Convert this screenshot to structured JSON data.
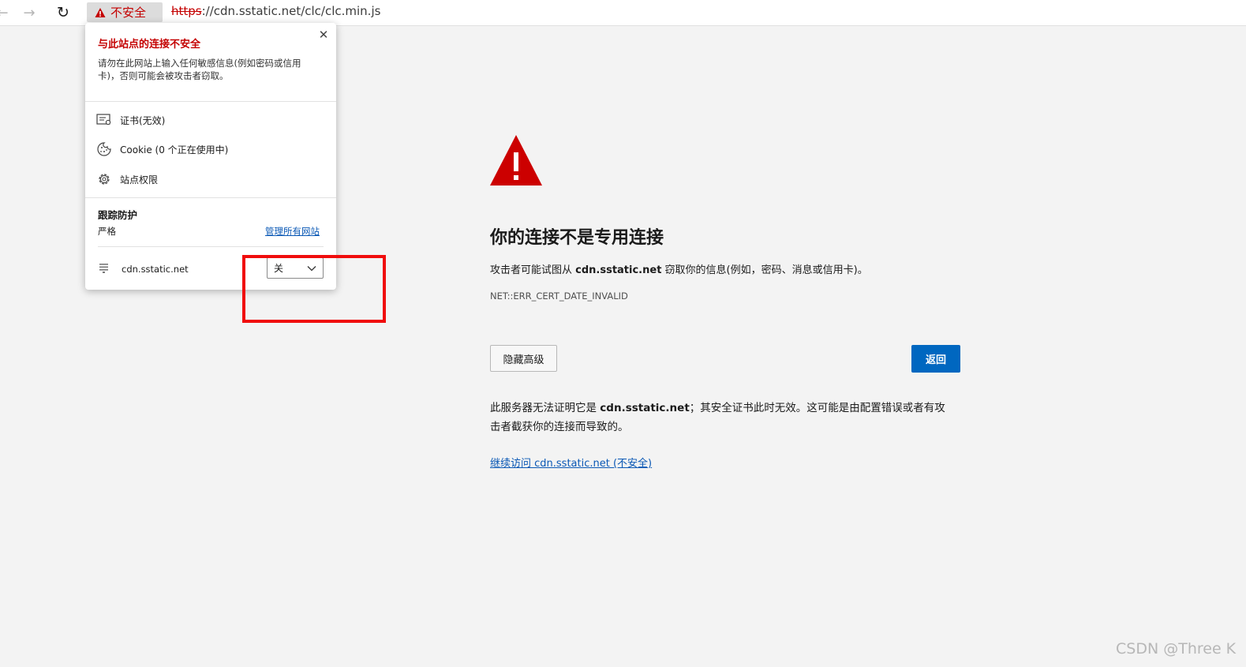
{
  "address_bar": {
    "security_label": "不安全",
    "url_scheme": "https",
    "url_rest": "://cdn.sstatic.net/clc/clc.min.js"
  },
  "error_page": {
    "title": "你的连接不是专用连接",
    "desc_prefix": "攻击者可能试图从 ",
    "desc_domain": "cdn.sstatic.net",
    "desc_suffix": " 窃取你的信息(例如，密码、消息或信用卡)。",
    "error_code": "NET::ERR_CERT_DATE_INVALID",
    "advanced_button": "隐藏高级",
    "back_button": "返回",
    "advanced_prefix": "此服务器无法证明它是 ",
    "advanced_domain": "cdn.sstatic.net",
    "advanced_suffix": "；其安全证书此时无效。这可能是由配置错误或者有攻击者截获你的连接而导致的。",
    "proceed_link": "继续访问 cdn.sstatic.net (不安全)"
  },
  "popup": {
    "close_glyph": "✕",
    "title": "与此站点的连接不安全",
    "warning": "请勿在此网站上输入任何敏感信息(例如密码或信用卡)，否则可能会被攻击者窃取。",
    "items": [
      {
        "label": "证书(无效)",
        "icon": "certificate-icon"
      },
      {
        "label": "Cookie (0 个正在使用中)",
        "icon": "cookie-icon"
      },
      {
        "label": "站点权限",
        "icon": "gear-icon"
      }
    ],
    "tracking": {
      "heading": "跟踪防护",
      "level": "严格",
      "manage_link": "管理所有网站"
    },
    "site": {
      "name": "cdn.sstatic.net",
      "toggle_value": "关"
    }
  },
  "watermark": "CSDN @Three K",
  "colors": {
    "danger": "#c40000",
    "accent": "#0067c0",
    "annotation": "#f00d0d",
    "link": "#0a58b5"
  }
}
